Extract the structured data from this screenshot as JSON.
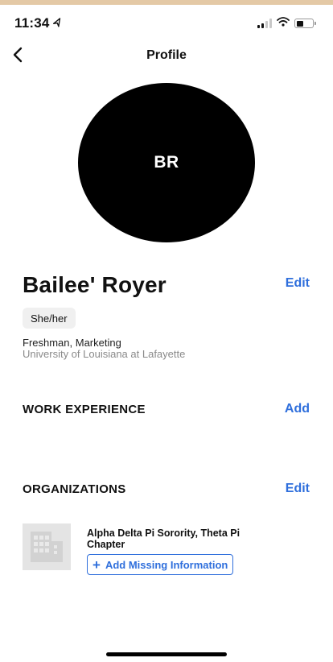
{
  "status_bar": {
    "time": "11:34",
    "location_icon": "location-arrow-icon",
    "signal_icon": "cellular-signal-icon",
    "wifi_icon": "wifi-icon",
    "battery_icon": "battery-icon"
  },
  "nav": {
    "title": "Profile",
    "back_icon": "chevron-left-icon"
  },
  "profile": {
    "initials": "BR",
    "name": "Bailee' Royer",
    "edit_label": "Edit",
    "pronouns": "She/her",
    "class_major": "Freshman, Marketing",
    "school": "University of Louisiana at Lafayette"
  },
  "work_experience": {
    "title": "WORK EXPERIENCE",
    "add_label": "Add"
  },
  "organizations": {
    "title": "ORGANIZATIONS",
    "edit_label": "Edit",
    "items": [
      {
        "name": "Alpha Delta Pi Sorority, Theta Pi Chapter",
        "icon": "building-icon",
        "add_missing_label": "Add Missing Information"
      }
    ]
  },
  "colors": {
    "accent": "#2f6fdc",
    "avatar_bg": "#000000",
    "top_strip": "#e4c9a6"
  }
}
